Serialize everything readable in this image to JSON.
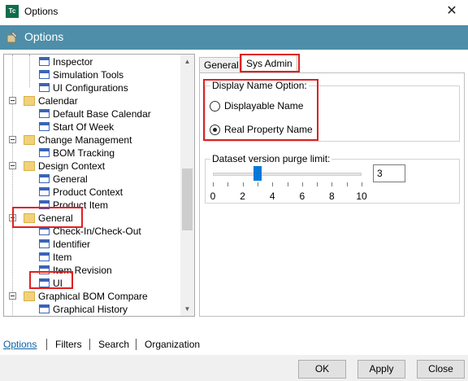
{
  "window": {
    "title": "Options",
    "app_icon_text": "Tc",
    "close_glyph": "✕"
  },
  "header": {
    "title": "Options",
    "icon": "options-icon"
  },
  "tree": {
    "items": [
      {
        "label": "Inspector",
        "icon": "node-icon"
      },
      {
        "label": "Simulation Tools",
        "icon": "node-icon"
      },
      {
        "label": "UI Configurations",
        "icon": "node-icon"
      },
      {
        "label": "Calendar",
        "icon": "folder-icon"
      },
      {
        "label": "Default Base Calendar",
        "icon": "node-icon"
      },
      {
        "label": "Start Of Week",
        "icon": "node-icon"
      },
      {
        "label": "Change Management",
        "icon": "folder-icon"
      },
      {
        "label": "BOM Tracking",
        "icon": "node-icon"
      },
      {
        "label": "Design Context",
        "icon": "folder-icon"
      },
      {
        "label": "General",
        "icon": "node-icon"
      },
      {
        "label": "Product Context",
        "icon": "node-icon"
      },
      {
        "label": "Product Item",
        "icon": "node-icon"
      },
      {
        "label": "General",
        "icon": "folder-icon"
      },
      {
        "label": "Check-In/Check-Out",
        "icon": "node-icon"
      },
      {
        "label": "Identifier",
        "icon": "node-icon"
      },
      {
        "label": "Item",
        "icon": "node-icon"
      },
      {
        "label": "Item Revision",
        "icon": "node-icon"
      },
      {
        "label": "UI",
        "icon": "node-icon"
      },
      {
        "label": "Graphical BOM Compare",
        "icon": "folder-icon"
      },
      {
        "label": "Graphical History",
        "icon": "node-icon"
      }
    ]
  },
  "tabs": [
    {
      "label": "General"
    },
    {
      "label": "Sys Admin",
      "active": true
    }
  ],
  "display_name": {
    "group_title": "Display Name Option:",
    "options": [
      {
        "label": "Displayable Name",
        "checked": false
      },
      {
        "label": "Real Property Name",
        "checked": true
      }
    ]
  },
  "dataset": {
    "group_title": "Dataset version purge limit:",
    "slider_min": 0,
    "slider_max": 10,
    "slider_value": 3,
    "tick_labels": [
      "0",
      "2",
      "4",
      "6",
      "8",
      "10"
    ],
    "input_value": "3"
  },
  "bottom_links": [
    "Options",
    "Filters",
    "Search",
    "Organization"
  ],
  "buttons": {
    "ok": "OK",
    "apply": "Apply",
    "close": "Close"
  },
  "colors": {
    "header_bg": "#4e8ea9",
    "highlight": "#e02020",
    "slider_thumb": "#0078d7"
  }
}
